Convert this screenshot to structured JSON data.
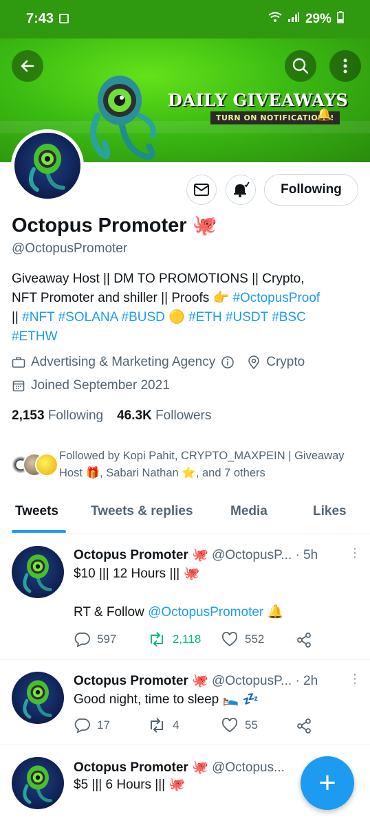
{
  "status_bar": {
    "time": "7:43",
    "battery": "29%"
  },
  "banner": {
    "title": "DAILY GIVEAWAYS",
    "subtitle": "TURN ON NOTIFICATIONS!"
  },
  "profile": {
    "name": "Octopus Promoter",
    "name_emoji": "🐙",
    "handle": "@OctopusPromoter",
    "following_button": "Following",
    "bio": {
      "line1": "Giveaway Host || DM TO PROMOTIONS || Crypto,",
      "line2_text": "NFT Promoter and shiller || Proofs 👉 ",
      "line2_tag": "#OctopusProof",
      "line3_prefix": "|| ",
      "tags_line3": [
        "#NFT",
        "#SOLANA",
        "#BUSD"
      ],
      "busd_emoji": "🟡",
      "tags_line3b": [
        "#ETH",
        "#USDT",
        "#BSC"
      ],
      "tag_line4": "#ETHW"
    },
    "category": "Advertising & Marketing Agency",
    "location": "Crypto",
    "joined": "Joined September 2021",
    "following_count": "2,153",
    "following_label": "Following",
    "followers_count": "46.3K",
    "followers_label": "Followers",
    "followed_by": "Followed by Kopi Pahit, CRYPTO_MAXPEIN | Giveaway Host 🎁, Sabari Nathan ⭐, and 7 others"
  },
  "tabs": [
    "Tweets",
    "Tweets & replies",
    "Media",
    "Likes"
  ],
  "tweets": [
    {
      "name": "Octopus Promoter",
      "emoji": "🐙",
      "handle": "@OctopusP...",
      "time": "· 5h",
      "line1": "$10 ||| 12 Hours ||| 🐙",
      "line2_prefix": "RT & Follow ",
      "line2_mention": "@OctopusPromoter",
      "line2_suffix": " 🔔",
      "replies": "597",
      "retweets": "2,118",
      "likes": "552"
    },
    {
      "name": "Octopus Promoter",
      "emoji": "🐙",
      "handle": "@OctopusP...",
      "time": "· 2h",
      "line1": "Good night, time to sleep 🛌 💤",
      "replies": "17",
      "retweets": "4",
      "likes": "55"
    },
    {
      "name": "Octopus Promoter",
      "emoji": "🐙",
      "handle": "@Octopus...",
      "time": "",
      "line1": "$5 ||| 6 Hours ||| 🐙"
    }
  ],
  "fab": {
    "label": "+"
  },
  "colors": {
    "accent": "#1d9bf0",
    "banner_green": "#3bbb12",
    "retweet_green": "#00ba7c"
  }
}
